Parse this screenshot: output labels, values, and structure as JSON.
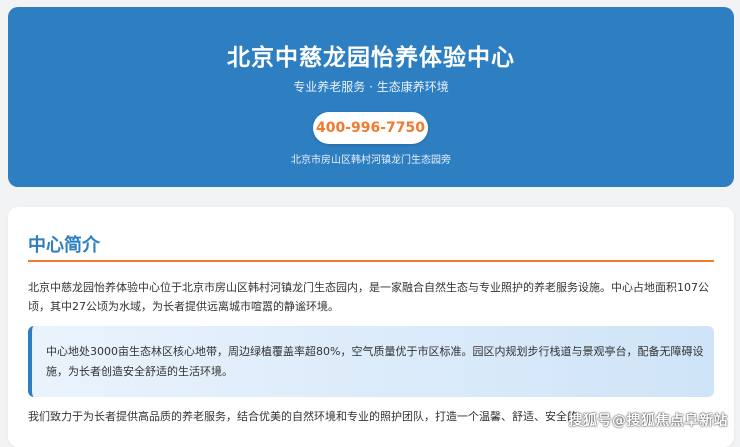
{
  "hero": {
    "title": "北京中慈龙园怡养体验中心",
    "subtitle": "专业养老服务 · 生态康养环境",
    "phone": "400-996-7750",
    "address": "北京市房山区韩村河镇龙门生态园旁"
  },
  "intro": {
    "title": "中心简介",
    "paragraph_1": "北京中慈龙园怡养体验中心位于北京市房山区韩村河镇龙门生态园内，是一家融合自然生态与专业照护的养老服务设施。中心占地面积107公顷，其中27公顷为水域，为长者提供远离城市喧嚣的静谧环境。",
    "highlight": "中心地处3000亩生态林区核心地带，周边绿植覆盖率超80%，空气质量优于市区标准。园区内规划步行栈道与景观亭台，配备无障碍设施，为长者创造安全舒适的生活环境。",
    "paragraph_2": "我们致力于为长者提供高品质的养老服务，结合优美的自然环境和专业的照护团队，打造一个温馨、舒适、安全的"
  },
  "watermark": "搜狐号@搜狐焦点阜新站",
  "colors": {
    "primary": "#2e7ec2",
    "accent": "#f07a2e",
    "background": "#f2f3f5"
  }
}
